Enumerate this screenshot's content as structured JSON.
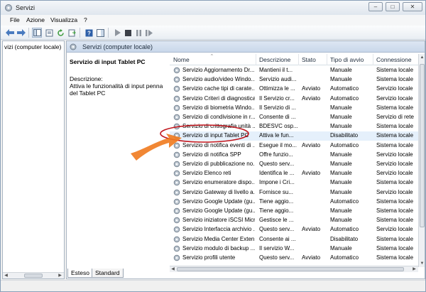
{
  "window": {
    "title": "Servizi"
  },
  "window_buttons": {
    "minimize": "–",
    "maximize": "□",
    "close": "✕"
  },
  "menu": [
    "File",
    "Azione",
    "Visualizza",
    "?"
  ],
  "toolbar": {
    "icons": [
      "back-arrow-icon",
      "forward-arrow-icon",
      "console-tree-icon",
      "properties-icon",
      "refresh-icon",
      "export-list-icon",
      "help-icon",
      "panel-icon",
      "play-icon",
      "stop-icon",
      "pause-icon",
      "restart-icon"
    ]
  },
  "tree": {
    "root_label": "vizi (computer locale)"
  },
  "content_header": {
    "title": "Servizi (computer locale)"
  },
  "detail": {
    "service_title": "Servizio di input Tablet PC",
    "description_label": "Descrizione:",
    "description_text": "Attiva le funzionalità di input penna del Tablet PC"
  },
  "table": {
    "columns": [
      "Nome",
      "Descrizione",
      "Stato",
      "Tipo di avvio",
      "Connessione"
    ],
    "sort_indicator": "^",
    "rows": [
      {
        "name": "Servizio Aggiornamento Dr...",
        "desc": "Mantieni il t...",
        "state": "",
        "startup": "Manuale",
        "logon": "Sistema locale"
      },
      {
        "name": "Servizio audio/video Windo...",
        "desc": "Servizio audi...",
        "state": "",
        "startup": "Manuale",
        "logon": "Sistema locale"
      },
      {
        "name": "Servizio cache tipi di carate...",
        "desc": "Ottimizza le ...",
        "state": "Avviato",
        "startup": "Automatico",
        "logon": "Servizio locale"
      },
      {
        "name": "Servizio Criteri di diagnostica",
        "desc": "Il Servizio cr...",
        "state": "Avviato",
        "startup": "Automatico",
        "logon": "Servizio locale"
      },
      {
        "name": "Servizio di biometria Windo...",
        "desc": "Il Servizio di ...",
        "state": "",
        "startup": "Manuale",
        "logon": "Sistema locale"
      },
      {
        "name": "Servizio di condivisione in r...",
        "desc": "Consente di ...",
        "state": "",
        "startup": "Manuale",
        "logon": "Servizio di rete"
      },
      {
        "name": "Servizio di crittografia unità ...",
        "desc": "BDESVC osp...",
        "state": "",
        "startup": "Manuale",
        "logon": "Sistema locale"
      },
      {
        "name": "Servizio di input Tablet PC",
        "desc": "Attiva le fun...",
        "state": "",
        "startup": "Disabilitato",
        "logon": "Sistema locale"
      },
      {
        "name": "Servizio di notifica eventi di ...",
        "desc": "Esegue il mo...",
        "state": "Avviato",
        "startup": "Automatico",
        "logon": "Sistema locale"
      },
      {
        "name": "Servizio di notifica SPP",
        "desc": "Offre funzio...",
        "state": "",
        "startup": "Manuale",
        "logon": "Servizio locale"
      },
      {
        "name": "Servizio di pubblicazione no...",
        "desc": "Questo serv...",
        "state": "",
        "startup": "Manuale",
        "logon": "Servizio locale"
      },
      {
        "name": "Servizio Elenco reti",
        "desc": "Identifica le ...",
        "state": "Avviato",
        "startup": "Manuale",
        "logon": "Servizio locale"
      },
      {
        "name": "Servizio enumeratore dispo...",
        "desc": "Impone i Cri...",
        "state": "",
        "startup": "Manuale",
        "logon": "Sistema locale"
      },
      {
        "name": "Servizio Gateway di livello a...",
        "desc": "Fornisce su...",
        "state": "",
        "startup": "Manuale",
        "logon": "Servizio locale"
      },
      {
        "name": "Servizio Google Update (gu...",
        "desc": "Tiene aggio...",
        "state": "",
        "startup": "Automatico",
        "logon": "Sistema locale"
      },
      {
        "name": "Servizio Google Update (gu...",
        "desc": "Tiene aggio...",
        "state": "",
        "startup": "Manuale",
        "logon": "Sistema locale"
      },
      {
        "name": "Servizio iniziatore iSCSI Micr...",
        "desc": "Gestisce le ...",
        "state": "",
        "startup": "Manuale",
        "logon": "Sistema locale"
      },
      {
        "name": "Servizio Interfaccia archivio ...",
        "desc": "Questo serv...",
        "state": "Avviato",
        "startup": "Automatico",
        "logon": "Servizio locale"
      },
      {
        "name": "Servizio Media Center Exten...",
        "desc": "Consente ai ...",
        "state": "",
        "startup": "Disabilitato",
        "logon": "Sistema locale"
      },
      {
        "name": "Servizio modulo di backup ...",
        "desc": "Il servizio W...",
        "state": "",
        "startup": "Manuale",
        "logon": "Sistema locale"
      },
      {
        "name": "Servizio profili utente",
        "desc": "Questo serv...",
        "state": "Avviato",
        "startup": "Automatico",
        "logon": "Sistema locale"
      }
    ],
    "selected_index": 7
  },
  "tabs": [
    "Esteso",
    "Standard"
  ],
  "colors": {
    "accent_arrow": "#f07a1e",
    "annotation_ring": "#c0141b",
    "selection": "#e5f0fb"
  }
}
